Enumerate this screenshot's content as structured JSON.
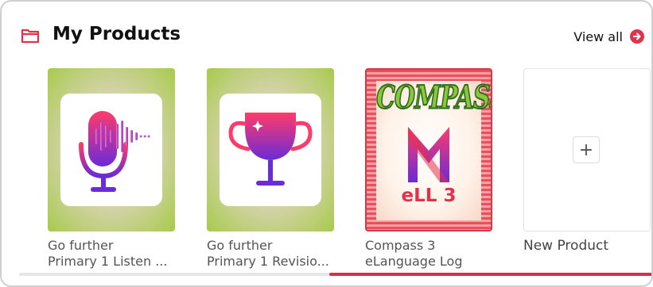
{
  "header": {
    "title": "My Products",
    "view_all_label": "View all",
    "icons": {
      "folder": "folder-icon",
      "view_all": "arrow-circle-right-icon"
    },
    "accent_color": "#e0324a"
  },
  "products": [
    {
      "line1": "Go further",
      "line2": "Primary 1 Listen ...",
      "icon": "microphone-icon"
    },
    {
      "line1": "Go further",
      "line2": "Primary 1 Revisio...",
      "icon": "trophy-icon"
    },
    {
      "line1": "Compass 3",
      "line2": "eLanguage Log",
      "cover_title": "COMPASS",
      "cover_subtitle": "eLL 3"
    }
  ],
  "new_product": {
    "label": "New Product",
    "icon": "plus-icon"
  },
  "scroll": {
    "thumb_start": 0.49,
    "thumb_end": 1.0
  }
}
